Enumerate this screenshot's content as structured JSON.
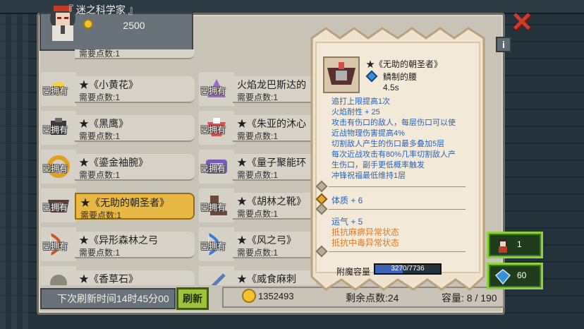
{
  "player": {
    "name": "『 迷之科学家 』",
    "gold": "2500"
  },
  "items": [
    {
      "name": "★《小黄花》",
      "cost": "需要点数:1",
      "owned": "已拥有",
      "icon": "yellow-flower-icon"
    },
    {
      "name": "火焰龙巴斯达的",
      "cost": "需要点数:1",
      "owned": "已拥有",
      "icon": "fire-dragon-icon"
    },
    {
      "name": "★《黑鹰》",
      "cost": "需要点数:1",
      "owned": "已拥有",
      "icon": "black-hawk-icon"
    },
    {
      "name": "★《朱亚的沐心",
      "cost": "需要点数:1",
      "owned": "已拥有",
      "icon": "ribbon-icon"
    },
    {
      "name": "★《鎏金袖腕》",
      "cost": "需要点数:1",
      "owned": "已拥有",
      "icon": "gold-bracer-icon"
    },
    {
      "name": "★《量子聚能环",
      "cost": "需要点数:1",
      "owned": "已拥有",
      "icon": "quantum-ring-icon"
    },
    {
      "name": "★《无助的朝圣者》",
      "cost": "需要点数:1",
      "owned": "已拥有",
      "icon": "pilgrim-belt-icon"
    },
    {
      "name": "★《胡林之靴》",
      "cost": "需要点数:1",
      "owned": "已拥有",
      "icon": "boots-icon"
    },
    {
      "name": "★《异形森林之弓",
      "cost": "需要点数:1",
      "owned": "已拥有",
      "icon": "forest-bow-icon"
    },
    {
      "name": "★《风之弓》",
      "cost": "需要点数:1",
      "owned": "已拥有",
      "icon": "wind-bow-icon"
    },
    {
      "name": "★《香草石》",
      "cost": "需要点数:1",
      "owned": "已拥有",
      "icon": "stone-icon"
    },
    {
      "name": "★《威食麻刺",
      "cost": "需要点数:1",
      "owned": "已拥有",
      "icon": "sword-icon"
    }
  ],
  "top_partial_cost": "需要点数:1",
  "bottom": {
    "refresh_time": "下次刷新时间14时45分00",
    "refresh_button": "刷新",
    "money": "1352493",
    "remaining": "剩余点数:24",
    "capacity": "容量: 8 / 190"
  },
  "tooltip": {
    "title": "★《无助的朝圣者》",
    "type": "鳞制的腰",
    "time": "4.5s",
    "effects": [
      "追打上限提高1次",
      "火焰耐性 + 25",
      "攻击有伤口的敌人，每层伤口可以使",
      "近战物理伤害提高4%",
      "切割敌人产生的伤口最多叠加5层",
      "每次近战攻击有80%几率切割敌人产",
      "生伤口，副手更低概率触发",
      "冲锋祝福最低维持1层"
    ],
    "stat1": "体质 + 6",
    "stat2": "运气 + 5",
    "resist1": "抵抗麻痹异常状态",
    "resist2": "抵抗中毒异常状态",
    "enchant_label": "附魔容量",
    "enchant_value": "3270/7736",
    "enchant_fraction": 0.4227
  },
  "counters": {
    "character": "1",
    "diamond": "60"
  },
  "colors": {
    "effect_blue": "#2a64b8",
    "effect_orange": "#e07a22",
    "selected": "#e7b844",
    "close": "#d03a2c"
  }
}
